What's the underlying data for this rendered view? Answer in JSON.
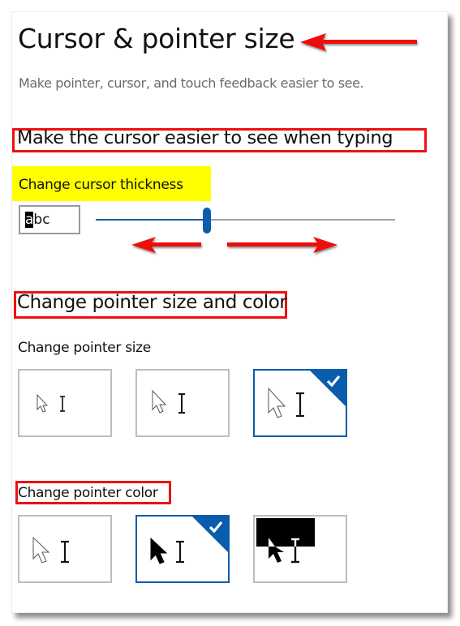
{
  "page": {
    "title": "Cursor & pointer size",
    "subtitle": "Make pointer, cursor, and touch feedback easier to see."
  },
  "cursor_section": {
    "heading": "Make the cursor easier to see when typing",
    "thickness_label": "Change cursor thickness",
    "preview_text_highlight": "a",
    "preview_text_rest": "bc",
    "thickness_slider": {
      "value_fraction": 0.37
    }
  },
  "pointer_section": {
    "heading": "Change pointer size and color",
    "size_label": "Change pointer size",
    "size_options": [
      {
        "name": "small",
        "selected": false
      },
      {
        "name": "medium",
        "selected": false
      },
      {
        "name": "large",
        "selected": true
      }
    ],
    "color_label": "Change pointer color",
    "color_options": [
      {
        "name": "white",
        "selected": false
      },
      {
        "name": "black",
        "selected": true
      },
      {
        "name": "inverted",
        "selected": false
      }
    ]
  },
  "annotations": {
    "highlight_color": "#ffff00",
    "box_color": "#ee1111",
    "arrow_color": "#ee1111"
  },
  "colors": {
    "accent": "#0a5cad",
    "tile_border": "#bdbdbd",
    "track_inactive": "#a3a3a3"
  }
}
